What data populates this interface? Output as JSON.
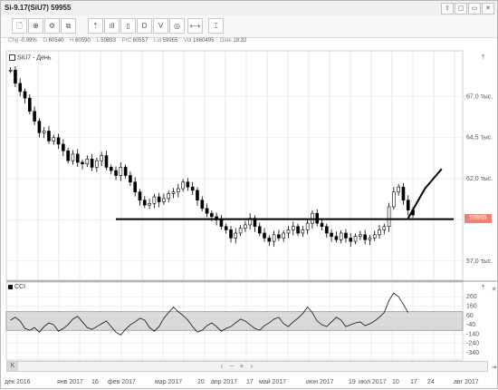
{
  "window": {
    "title": "Si-9.17(SiU7) 59955",
    "controls": [
      "⇪",
      "▢",
      "▭",
      "✕"
    ]
  },
  "toolbar": {
    "buttons": [
      "🗋",
      "⊕",
      "⚙",
      "⧉",
      "⇡",
      "ıll",
      "▯",
      "D",
      "V",
      "◎",
      "⟷",
      "⌶"
    ]
  },
  "info": [
    {
      "k": "Chg",
      "v": "-0,99%"
    },
    {
      "k": "O",
      "v": "60540"
    },
    {
      "k": "H",
      "v": "60590"
    },
    {
      "k": "L",
      "v": "59893"
    },
    {
      "k": "PrC",
      "v": "60557"
    },
    {
      "k": "Lst",
      "v": "59955"
    },
    {
      "k": "Vol",
      "v": "1860495"
    },
    {
      "k": "Date",
      "v": "18:32"
    }
  ],
  "main_legend": "SiU7 - День",
  "cci_legend": "CCI",
  "last_price": "59955",
  "colors": {
    "candles": "#000000",
    "cci_band": "#d9d9d9",
    "price_tag": "#f08070",
    "grid": "#d6d6d6"
  },
  "chart_data": [
    {
      "type": "line",
      "title": "SiU7 - День",
      "ylim": [
        56000,
        69500
      ],
      "yticks": [
        {
          "value": 67000,
          "label": "67,0 тыс."
        },
        {
          "value": 64500,
          "label": "64,5 тыс."
        },
        {
          "value": 62000,
          "label": "62,0 тыс."
        },
        {
          "value": 59500,
          "label": "59,5 тыс."
        },
        {
          "value": 57000,
          "label": "57,0 тыс."
        }
      ],
      "xticks": [
        "дек 2016",
        "янв 2017",
        "16",
        "фев 2017",
        "мар 2017",
        "20",
        "апр 2017",
        "17",
        "май 2017",
        "июн 2017",
        "19",
        "июл 2017",
        "10",
        "17",
        "24",
        "авг 2017"
      ],
      "series": [
        {
          "values": [
            68600,
            67800,
            67300,
            66900,
            66100,
            65500,
            64800,
            64900,
            64300,
            64500,
            64100,
            63700,
            63100,
            63500,
            63000,
            62900,
            63200,
            62700,
            63100,
            63400,
            62700,
            62500,
            62200,
            62700,
            62200,
            61800,
            61200,
            60700,
            60400,
            60500,
            60900,
            60600,
            60800,
            61100,
            61200,
            61400,
            61800,
            61500,
            61300,
            60700,
            60200,
            59900,
            59700,
            59500,
            59100,
            58900,
            58400,
            58700,
            59000,
            59200,
            59600,
            59100,
            58700,
            58400,
            58200,
            58600,
            58400,
            58700,
            58900,
            59100,
            58700,
            58900,
            59300,
            59900,
            59300,
            59100,
            58700,
            58500,
            58300,
            58700,
            58400,
            58200,
            58500,
            58600,
            58300,
            58400,
            58600,
            58900,
            59100,
            60300,
            61200,
            61500,
            60700,
            60100,
            59800
          ]
        }
      ],
      "annotations": {
        "support_level": 59550,
        "projection": [
          {
            "i": 83,
            "v": 59600
          },
          {
            "i": 90,
            "v": 62600
          }
        ]
      }
    },
    {
      "type": "line",
      "title": "CCI",
      "ylim": [
        -400,
        340
      ],
      "yticks": [
        260,
        160,
        60,
        -40,
        -140,
        -240,
        -340
      ],
      "band": [
        -100,
        100
      ],
      "series": [
        {
          "values": [
            10,
            40,
            0,
            -80,
            -100,
            -70,
            -120,
            -60,
            -20,
            -40,
            -110,
            -80,
            -40,
            20,
            50,
            -10,
            -70,
            -90,
            -60,
            -30,
            0,
            -60,
            -120,
            -150,
            -90,
            -40,
            -10,
            30,
            10,
            -70,
            -110,
            -60,
            30,
            90,
            150,
            100,
            60,
            10,
            -60,
            -120,
            -100,
            -50,
            -20,
            -60,
            -110,
            -80,
            -60,
            -20,
            20,
            0,
            -40,
            -80,
            -100,
            -50,
            -20,
            20,
            40,
            -30,
            -60,
            -10,
            30,
            80,
            150,
            90,
            0,
            -40,
            -60,
            -10,
            40,
            10,
            -60,
            -40,
            -20,
            -10,
            -50,
            -30,
            0,
            40,
            90,
            220,
            300,
            260,
            180,
            90
          ]
        }
      ]
    }
  ]
}
